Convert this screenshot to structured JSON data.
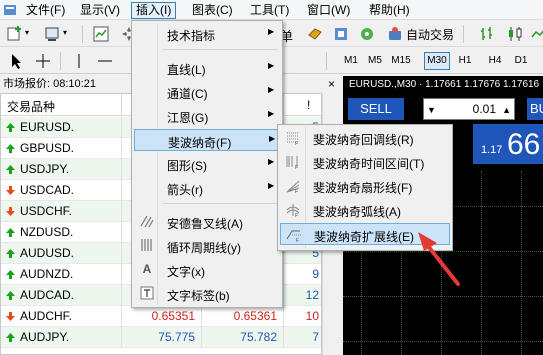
{
  "menubar": {
    "items": [
      {
        "label": "文件(F)",
        "name": "menu-file"
      },
      {
        "label": "显示(V)",
        "name": "menu-view"
      },
      {
        "label": "插入(I)",
        "name": "menu-insert"
      },
      {
        "label": "图表(C)",
        "name": "menu-charts"
      },
      {
        "label": "工具(T)",
        "name": "menu-tools"
      },
      {
        "label": "窗口(W)",
        "name": "menu-window"
      },
      {
        "label": "帮助(H)",
        "name": "menu-help"
      }
    ]
  },
  "toolbar": {
    "partial_label": "单",
    "autotrading_label": "自动交易",
    "timeframes": [
      "M1",
      "M5",
      "M15",
      "M30",
      "H1",
      "H4",
      "D1"
    ],
    "selected_timeframe": "M30",
    "f_label": "F"
  },
  "market_watch": {
    "title": "市场报价: 08:10:21",
    "close_glyph": "×",
    "column_symbol": "交易品种",
    "column_last": "!",
    "rows": [
      {
        "symbol": "EURUSD.",
        "dir": "up",
        "bid": "",
        "ask": "",
        "spread": "5"
      },
      {
        "symbol": "GBPUSD.",
        "dir": "up",
        "bid": "",
        "ask": "",
        "spread": "9"
      },
      {
        "symbol": "USDJPY.",
        "dir": "up",
        "bid": "",
        "ask": "",
        "spread": "7"
      },
      {
        "symbol": "USDCAD.",
        "dir": "down",
        "bid": "",
        "ask": "",
        "spread": "7"
      },
      {
        "symbol": "USDCHF.",
        "dir": "down",
        "bid": "",
        "ask": "",
        "spread": "9"
      },
      {
        "symbol": "NZDUSD.",
        "dir": "up",
        "bid": "",
        "ask": "",
        "spread": "12"
      },
      {
        "symbol": "AUDUSD.",
        "dir": "up",
        "bid": "",
        "ask": "",
        "spread": "5"
      },
      {
        "symbol": "AUDNZD.",
        "dir": "up",
        "bid": "",
        "ask": "",
        "spread": "9"
      },
      {
        "symbol": "AUDCAD.",
        "dir": "up",
        "bid": "",
        "ask": "",
        "spread": "12"
      },
      {
        "symbol": "AUDCHF.",
        "dir": "down",
        "bid": "0.65351",
        "ask": "0.65361",
        "spread": "10"
      },
      {
        "symbol": "AUDJPY.",
        "dir": "up",
        "bid": "75.775",
        "ask": "75.782",
        "spread": "7"
      }
    ]
  },
  "chart": {
    "title": "EURUSD.,M30 · 1.17661 1.17676 1.17616",
    "sell_label": "SELL",
    "lot_value": "0.01",
    "buy_label": "BU",
    "price_small": "1.17",
    "price_big": "66"
  },
  "insert_menu": {
    "items": [
      {
        "label": "技术指标",
        "submenu": true
      },
      {
        "label": "直线(L)",
        "submenu": true
      },
      {
        "label": "通道(C)",
        "submenu": true
      },
      {
        "label": "江恩(G)",
        "submenu": true
      },
      {
        "label": "斐波纳奇(F)",
        "submenu": true
      },
      {
        "label": "图形(S)",
        "submenu": true
      },
      {
        "label": "箭头(r)",
        "submenu": true
      },
      {
        "label": "安德鲁叉线(A)",
        "submenu": false
      },
      {
        "label": "循环周期线(y)",
        "submenu": false
      },
      {
        "label": "文字(x)",
        "submenu": false
      },
      {
        "label": "文字标签(b)",
        "submenu": false
      }
    ]
  },
  "fibo_submenu": {
    "items": [
      {
        "label": "斐波纳奇回调线(R)"
      },
      {
        "label": "斐波纳奇时间区间(T)"
      },
      {
        "label": "斐波纳奇扇形线(F)"
      },
      {
        "label": "斐波纳奇弧线(A)"
      },
      {
        "label": "斐波纳奇扩展线(E)"
      }
    ]
  }
}
